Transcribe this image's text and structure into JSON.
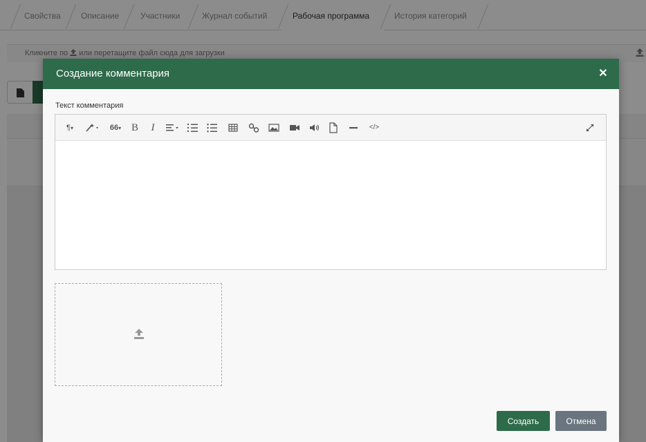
{
  "tabs": [
    {
      "label": "Свойства",
      "active": false
    },
    {
      "label": "Описание",
      "active": false
    },
    {
      "label": "Участники",
      "active": false
    },
    {
      "label": "Журнал событий",
      "active": false
    },
    {
      "label": "Рабочая программа",
      "active": true
    },
    {
      "label": "История категорий",
      "active": false
    }
  ],
  "upload_bar": {
    "text_before": "Кликните по",
    "icon": "upload-icon",
    "text_after": "или перетащите файл сюда для загрузки"
  },
  "modal": {
    "title": "Создание комментария",
    "close_icon": "close-icon",
    "field_label": "Текст комментария",
    "toolbar_icons": [
      "paragraph-format-icon",
      "magic-style-icon",
      "quote-icon",
      "bold-icon",
      "italic-icon",
      "align-icon",
      "ordered-list-icon",
      "unordered-list-icon",
      "table-icon",
      "link-icon",
      "image-icon",
      "video-icon",
      "audio-icon",
      "file-icon",
      "horizontal-rule-icon",
      "code-view-icon",
      "fullscreen-icon"
    ],
    "toolbar_glyphs": {
      "paragraph": "¶",
      "quote": "66",
      "bold": "B",
      "italic": "I",
      "code": "</>",
      "caret": "▾"
    },
    "editor_content": "",
    "dropzone_icon": "upload-icon",
    "create_label": "Создать",
    "cancel_label": "Отмена"
  },
  "colors": {
    "header_green": "#2e6b4a",
    "cancel_gray": "#6b7580",
    "overlay": "rgba(0,0,0,0.45)"
  }
}
